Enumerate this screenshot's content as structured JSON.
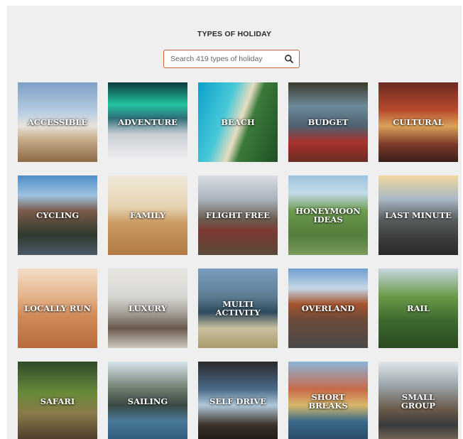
{
  "page": {
    "title": "TYPES OF HOLIDAY"
  },
  "search": {
    "placeholder": "Search 419 types of holiday",
    "icon": "search-icon"
  },
  "tiles": [
    {
      "label": "ACCESSIBLE"
    },
    {
      "label": "ADVENTURE"
    },
    {
      "label": "BEACH"
    },
    {
      "label": "BUDGET"
    },
    {
      "label": "CULTURAL"
    },
    {
      "label": "CYCLING"
    },
    {
      "label": "FAMILY"
    },
    {
      "label": "FLIGHT FREE"
    },
    {
      "label": "HONEYMOON\nIDEAS"
    },
    {
      "label": "LAST MINUTE"
    },
    {
      "label": "LOCALLY RUN"
    },
    {
      "label": "LUXURY"
    },
    {
      "label": "MULTI\nACTIVITY"
    },
    {
      "label": "OVERLAND"
    },
    {
      "label": "RAIL"
    },
    {
      "label": "SAFARI"
    },
    {
      "label": "SAILING"
    },
    {
      "label": "SELF DRIVE"
    },
    {
      "label": "SHORT\nBREAKS"
    },
    {
      "label": "SMALL\nGROUP"
    }
  ]
}
